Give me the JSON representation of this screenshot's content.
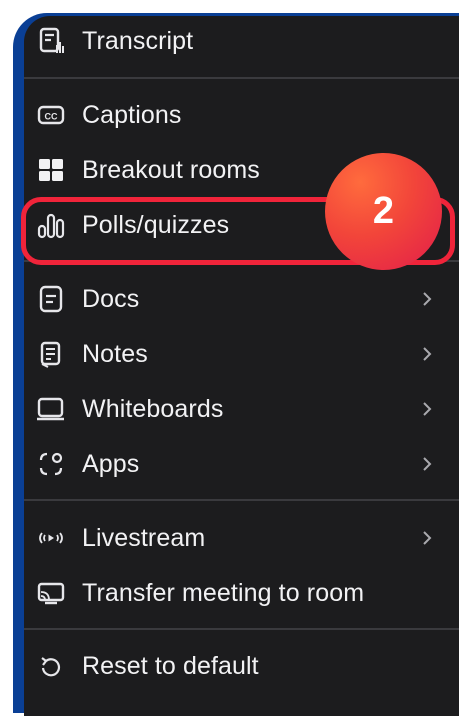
{
  "menu": {
    "items": [
      {
        "label": "Transcript",
        "icon": "transcript-icon",
        "submenu": false
      },
      {
        "label": "Captions",
        "icon": "captions-icon",
        "submenu": false
      },
      {
        "label": "Breakout rooms",
        "icon": "breakout-rooms-icon",
        "submenu": false
      },
      {
        "label": "Polls/quizzes",
        "icon": "polls-icon",
        "submenu": false
      },
      {
        "label": "Docs",
        "icon": "docs-icon",
        "submenu": true
      },
      {
        "label": "Notes",
        "icon": "notes-icon",
        "submenu": true
      },
      {
        "label": "Whiteboards",
        "icon": "whiteboard-icon",
        "submenu": true
      },
      {
        "label": "Apps",
        "icon": "apps-icon",
        "submenu": true
      },
      {
        "label": "Livestream",
        "icon": "livestream-icon",
        "submenu": true
      },
      {
        "label": "Transfer meeting to room",
        "icon": "transfer-room-icon",
        "submenu": false
      },
      {
        "label": "Reset to default",
        "icon": "reset-icon",
        "submenu": false
      }
    ]
  },
  "annotation": {
    "step_number": "2",
    "highlight_color": "#f0243a",
    "badge_color": "#f2453a"
  },
  "colors": {
    "menu_background": "#1c1c1e",
    "frame_border": "#0a3f95",
    "text": "#f2f2f4",
    "separator": "#3a3a3e"
  }
}
